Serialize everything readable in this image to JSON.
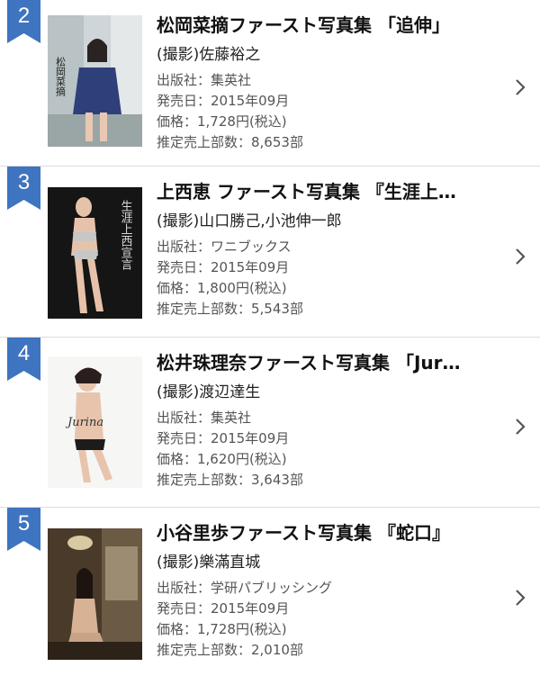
{
  "colors": {
    "ribbon": "#3e74c0",
    "chevron": "#555555",
    "divider": "#dcdcdc"
  },
  "items": [
    {
      "rank": "2",
      "title": "松岡菜摘ファースト写真集 「追伸」",
      "photographer": "(撮影)佐藤裕之",
      "publisher": "出版社：集英社",
      "release_date": "発売日：2015年09月",
      "price": "価格：1,728円(税込)",
      "sales": "推定売上部数：8,653部",
      "cover_text": "松岡菜摘",
      "cover_icon": "photobook-cover-image"
    },
    {
      "rank": "3",
      "title": "上西恵 ファースト写真集 『生涯上…",
      "photographer": "(撮影)山口勝己,小池伸一郎",
      "publisher": "出版社：ワニブックス",
      "release_date": "発売日：2015年09月",
      "price": "価格：1,800円(税込)",
      "sales": "推定売上部数：5,543部",
      "cover_text": "生涯上西宣言",
      "cover_icon": "photobook-cover-image"
    },
    {
      "rank": "4",
      "title": "松井珠理奈ファースト写真集 「Jur…",
      "photographer": "(撮影)渡辺達生",
      "publisher": "出版社：集英社",
      "release_date": "発売日：2015年09月",
      "price": "価格：1,620円(税込)",
      "sales": "推定売上部数：3,643部",
      "cover_text": "Jurina",
      "cover_icon": "photobook-cover-image"
    },
    {
      "rank": "5",
      "title": "小谷里歩ファースト写真集 『蛇口』",
      "photographer": "(撮影)樂滿直城",
      "publisher": "出版社：学研パブリッシング",
      "release_date": "発売日：2015年09月",
      "price": "価格：1,728円(税込)",
      "sales": "推定売上部数：2,010部",
      "cover_text": "",
      "cover_icon": "photobook-cover-image"
    }
  ]
}
